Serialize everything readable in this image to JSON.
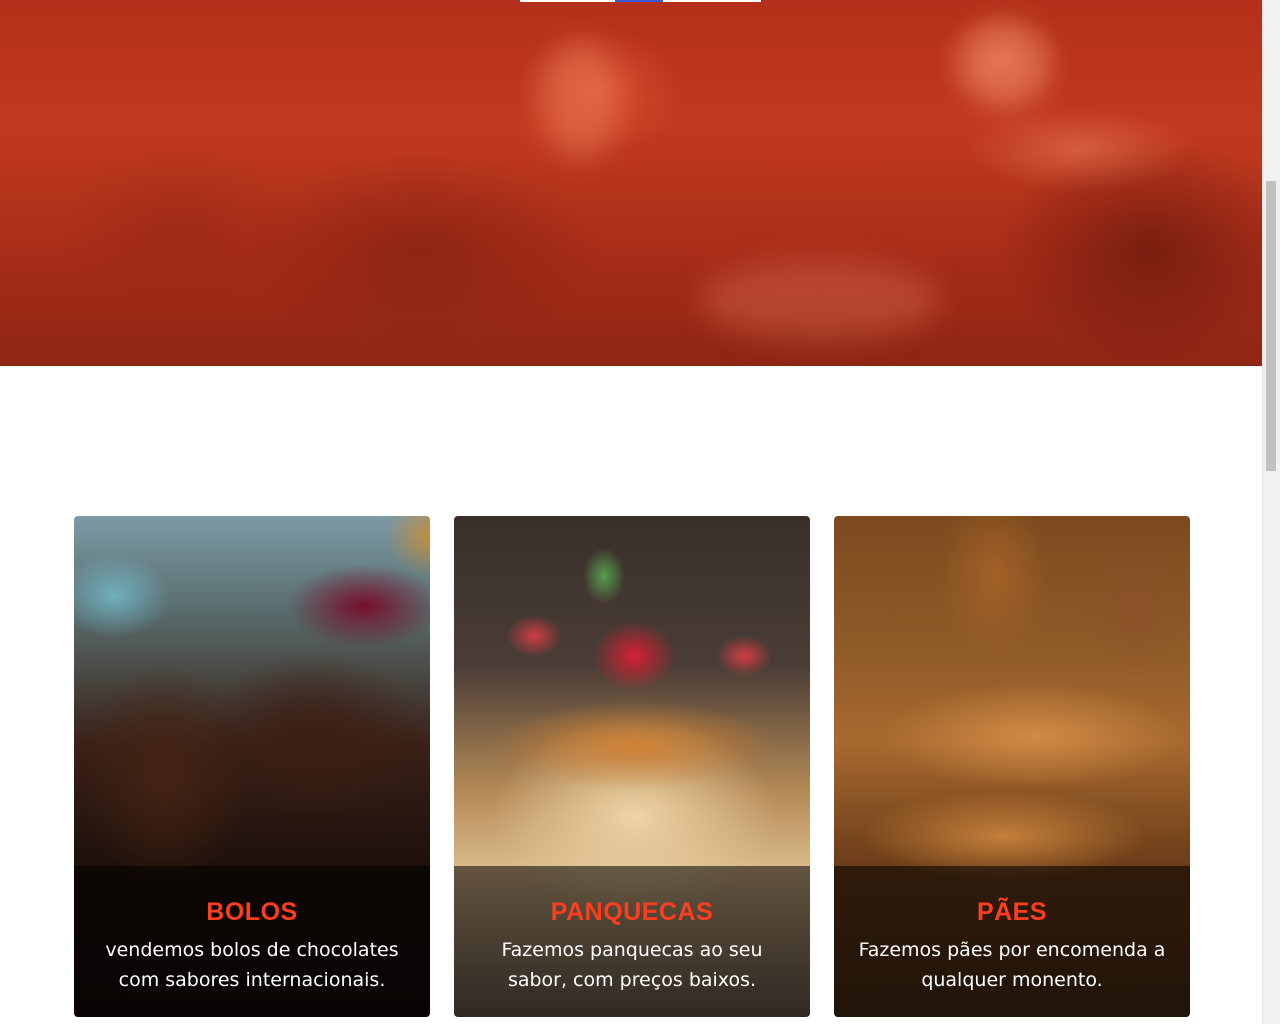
{
  "hero": {
    "image": "restaurant-dinner-photo",
    "tint_color": "#c0361c"
  },
  "cards": [
    {
      "image": "chocolate-cake-photo",
      "title": "BOLOS",
      "description": "vendemos bolos de chocolates com sabores internacionais."
    },
    {
      "image": "pancakes-photo",
      "title": "PANQUECAS",
      "description": "Fazemos panquecas ao seu sabor, com preços baixos."
    },
    {
      "image": "bread-photo",
      "title": "PÃES",
      "description": "Fazemos pães por encomenda a qualquer monento."
    }
  ],
  "colors": {
    "title_accent": "#ff3d1f",
    "caption_overlay": "rgba(0,0,0,0.55)"
  }
}
